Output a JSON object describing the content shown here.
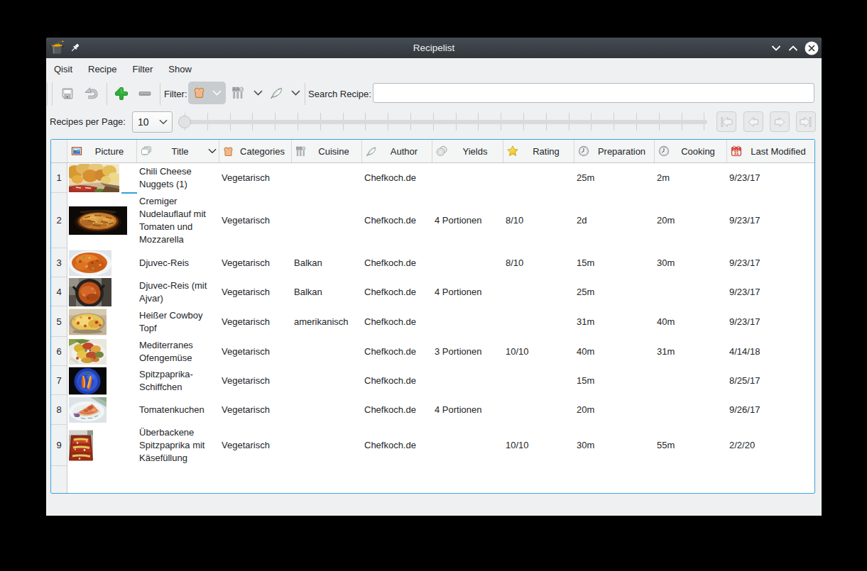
{
  "window": {
    "title": "Recipelist"
  },
  "menubar": {
    "items": [
      "Qisit",
      "Recipe",
      "Filter",
      "Show"
    ]
  },
  "toolbar": {
    "filter_label": "Filter:",
    "search_label": "Search Recipe:",
    "search_value": "",
    "icons": [
      "save-icon",
      "undo-icon",
      "add-icon",
      "remove-icon",
      "bread-icon",
      "cutlery-icon",
      "feather-icon"
    ]
  },
  "pager": {
    "label": "Recipes per Page:",
    "per_page": "10",
    "nav_icons": [
      "go-first-icon",
      "go-previous-icon",
      "go-next-icon",
      "go-last-icon"
    ]
  },
  "colors": {
    "accent_blue": "#3daee9",
    "add_green": "#27ae60",
    "titlebar": "#31363b",
    "window_bg": "#eff0f1"
  },
  "table": {
    "columns": [
      {
        "label": "Picture",
        "icon": "picture-icon"
      },
      {
        "label": "Title",
        "icon": "pages-icon",
        "sorted": true
      },
      {
        "label": "Categories",
        "icon": "bread-icon"
      },
      {
        "label": "Cuisine",
        "icon": "cutlery-icon"
      },
      {
        "label": "Author",
        "icon": "feather-icon"
      },
      {
        "label": "Yields",
        "icon": "plates-icon"
      },
      {
        "label": "Rating",
        "icon": "star-icon"
      },
      {
        "label": "Preparation",
        "icon": "clock-icon"
      },
      {
        "label": "Cooking",
        "icon": "clock-icon"
      },
      {
        "label": "Last Modified",
        "icon": "calendar-icon"
      }
    ],
    "rows": [
      {
        "num": "1",
        "title": "Chili Cheese Nuggets (1)",
        "categories": "Vegetarisch",
        "cuisine": "",
        "author": "Chefkoch.de",
        "yields": "",
        "rating": "",
        "preparation": "25m",
        "cooking": "2m",
        "last_modified": "9/23/17"
      },
      {
        "num": "2",
        "title": "Cremiger Nudelauflauf mit Tomaten und Mozzarella",
        "categories": "Vegetarisch",
        "cuisine": "",
        "author": "Chefkoch.de",
        "yields": "4 Portionen",
        "rating": "8/10",
        "preparation": "2d",
        "cooking": "20m",
        "last_modified": "9/23/17"
      },
      {
        "num": "3",
        "title": "Djuvec-Reis",
        "categories": "Vegetarisch",
        "cuisine": "Balkan",
        "author": "Chefkoch.de",
        "yields": "",
        "rating": "8/10",
        "preparation": "15m",
        "cooking": "30m",
        "last_modified": "9/23/17"
      },
      {
        "num": "4",
        "title": "Djuvec-Reis (mit Ajvar)",
        "categories": "Vegetarisch",
        "cuisine": "Balkan",
        "author": "Chefkoch.de",
        "yields": "4 Portionen",
        "rating": "",
        "preparation": "25m",
        "cooking": "",
        "last_modified": "9/23/17"
      },
      {
        "num": "5",
        "title": "Heißer Cowboy Topf",
        "categories": "Vegetarisch",
        "cuisine": "amerikanisch",
        "author": "Chefkoch.de",
        "yields": "",
        "rating": "",
        "preparation": "31m",
        "cooking": "40m",
        "last_modified": "9/23/17"
      },
      {
        "num": "6",
        "title": "Mediterranes Ofengemüse",
        "categories": "Vegetarisch",
        "cuisine": "",
        "author": "Chefkoch.de",
        "yields": "3 Portionen",
        "rating": "10/10",
        "preparation": "40m",
        "cooking": "31m",
        "last_modified": "4/14/18"
      },
      {
        "num": "7",
        "title": "Spitzpaprika-Schiffchen",
        "categories": "Vegetarisch",
        "cuisine": "",
        "author": "Chefkoch.de",
        "yields": "",
        "rating": "",
        "preparation": "15m",
        "cooking": "",
        "last_modified": "8/25/17"
      },
      {
        "num": "8",
        "title": "Tomatenkuchen",
        "categories": "Vegetarisch",
        "cuisine": "",
        "author": "Chefkoch.de",
        "yields": "4 Portionen",
        "rating": "",
        "preparation": "20m",
        "cooking": "",
        "last_modified": "9/26/17"
      },
      {
        "num": "9",
        "title": "Überbackene Spitzpaprika mit Käsefüllung",
        "categories": "Vegetarisch",
        "cuisine": "",
        "author": "Chefkoch.de",
        "yields": "",
        "rating": "10/10",
        "preparation": "30m",
        "cooking": "55m",
        "last_modified": "2/2/20"
      }
    ]
  }
}
